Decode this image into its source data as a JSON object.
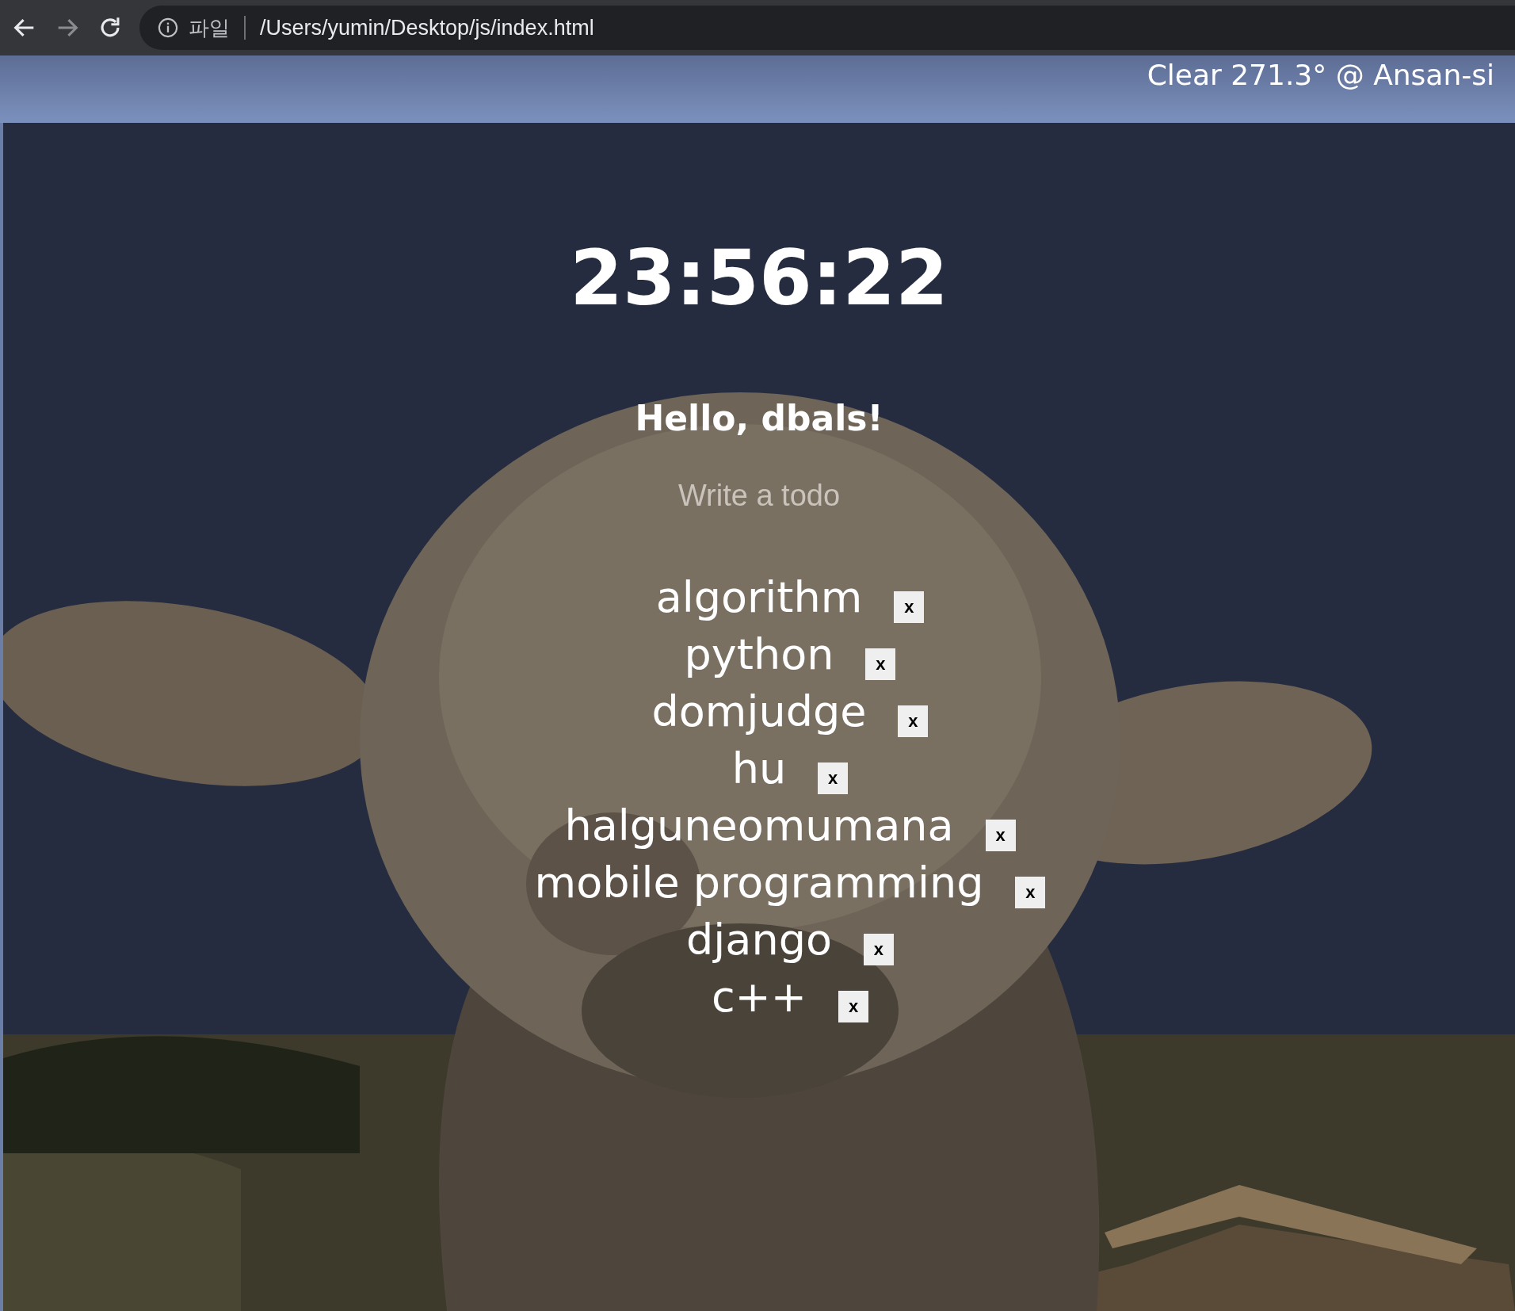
{
  "browser": {
    "back_disabled": false,
    "forward_disabled": true,
    "scheme_label": "파일",
    "url": "/Users/yumin/Desktop/js/index.html"
  },
  "weather": "Clear 271.3° @ Ansan-si",
  "clock": "23:56:22",
  "greeting": "Hello, dbals!",
  "todo_input": {
    "placeholder": "Write a todo"
  },
  "todos": [
    {
      "text": "algorithm",
      "delete_label": "x"
    },
    {
      "text": "python",
      "delete_label": "x"
    },
    {
      "text": "domjudge",
      "delete_label": "x"
    },
    {
      "text": "hu",
      "delete_label": "x"
    },
    {
      "text": "halguneomumana",
      "delete_label": "x"
    },
    {
      "text": "mobile programming",
      "delete_label": "x"
    },
    {
      "text": "django",
      "delete_label": "x"
    },
    {
      "text": "c++",
      "delete_label": "x"
    }
  ]
}
